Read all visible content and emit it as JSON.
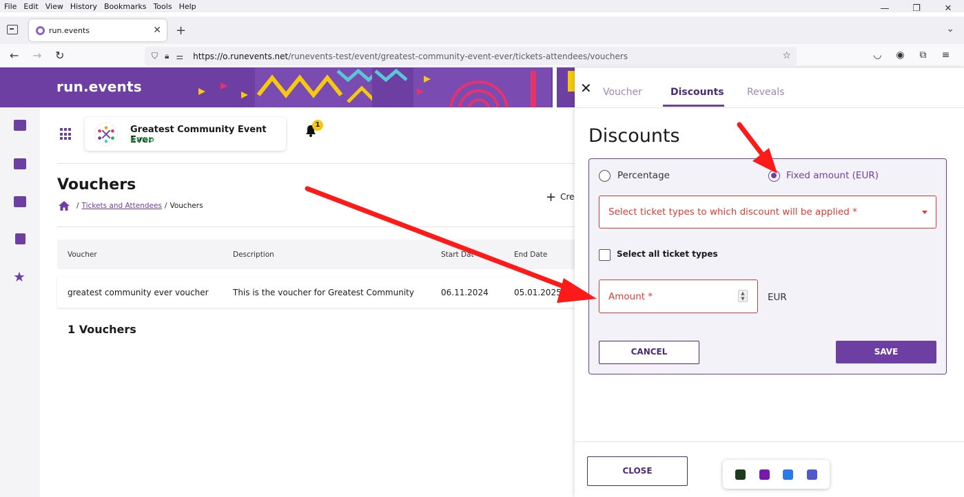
{
  "browser": {
    "menu": [
      "File",
      "Edit",
      "View",
      "History",
      "Bookmarks",
      "Tools",
      "Help"
    ],
    "tab_title": "run.events",
    "url_host": "https://o.runevents.net",
    "url_path": "/runevents-test/event/greatest-community-event-ever/tickets-attendees/vouchers"
  },
  "app": {
    "logo": "run.events",
    "event_name": "Greatest Community Event Ever",
    "event_badge": "DEMO",
    "notification_count": "1"
  },
  "page": {
    "title": "Vouchers",
    "breadcrumb_link": "Tickets and Attendees",
    "breadcrumb_current": "Vouchers",
    "create_label": "Cre",
    "table": {
      "headers": [
        "Voucher",
        "Description",
        "Start Date",
        "End Date"
      ],
      "rows": [
        [
          "greatest community ever voucher",
          "This is the voucher for Greatest Community",
          "06.11.2024",
          "05.01.2025"
        ]
      ]
    },
    "count_label": "1 Vouchers"
  },
  "drawer": {
    "tabs": [
      "Voucher",
      "Discounts",
      "Reveals"
    ],
    "active_tab": "Discounts",
    "title": "Discounts",
    "radio_percentage": "Percentage",
    "radio_fixed": "Fixed amount (EUR)",
    "selected_radio": "fixed",
    "ticket_select_placeholder": "Select ticket types to which discount will be applied *",
    "select_all_label": "Select all ticket types",
    "amount_placeholder": "Amount *",
    "currency": "EUR",
    "cancel_label": "CANCEL",
    "save_label": "SAVE",
    "close_label": "CLOSE"
  },
  "colors": {
    "brand": "#6e3fa3",
    "error": "#e53935",
    "annotation_arrow": "#ff0000"
  }
}
